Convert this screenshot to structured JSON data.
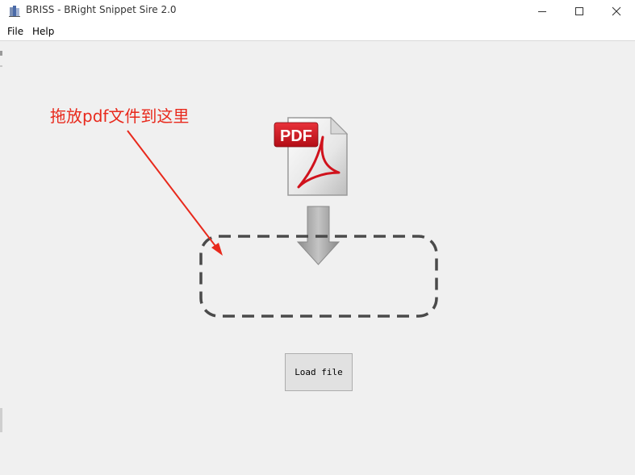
{
  "window": {
    "title": "BRISS - BRight Snippet Sire 2.0"
  },
  "menu": {
    "items": [
      "File",
      "Help"
    ]
  },
  "annotation": {
    "text": "拖放pdf文件到这里",
    "color": "#e8291c"
  },
  "pdf_icon": {
    "label": "PDF"
  },
  "drop_zone": {
    "label": ""
  },
  "load_button": {
    "label": "Load file"
  },
  "colors": {
    "background": "#f0f0f0",
    "accent_red": "#e8291c",
    "pdf_red": "#c8102e",
    "dash": "#4a4a4a"
  }
}
